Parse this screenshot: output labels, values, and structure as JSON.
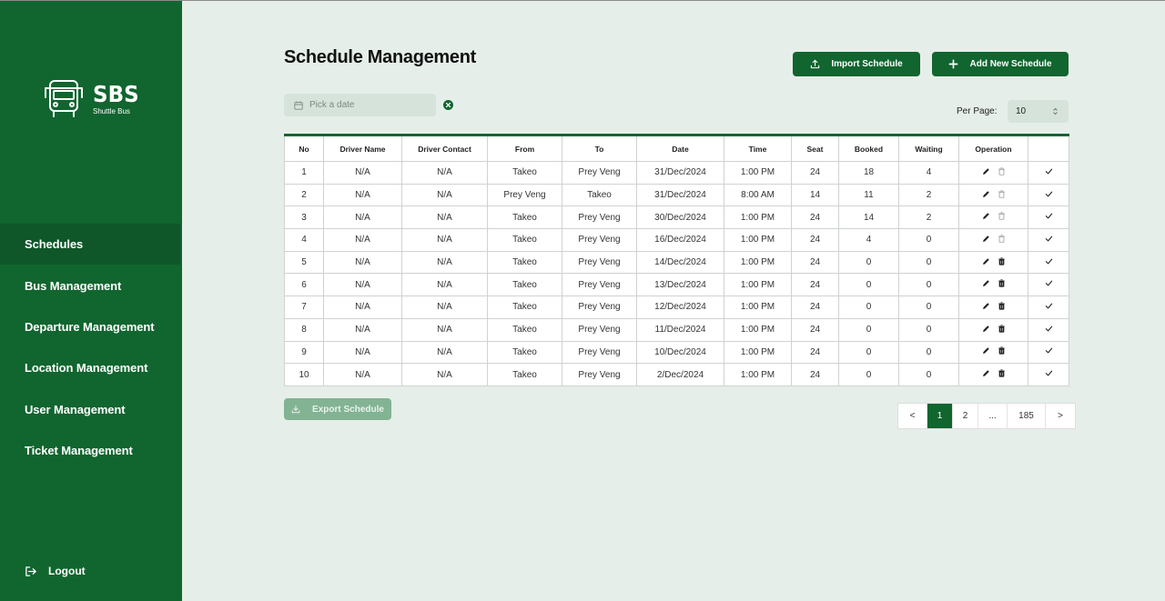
{
  "app": {
    "brand": "SBS",
    "brand_sub": "Shuttle Bus"
  },
  "sidebar": {
    "items": [
      {
        "label": "Schedules",
        "active": true
      },
      {
        "label": "Bus Management"
      },
      {
        "label": "Departure Management"
      },
      {
        "label": "Location Management"
      },
      {
        "label": "User Management"
      },
      {
        "label": "Ticket Management"
      }
    ],
    "logout_label": "Logout"
  },
  "header": {
    "title": "Schedule Management",
    "import_label": "Import Schedule",
    "add_label": "Add New Schedule"
  },
  "filters": {
    "date_placeholder": "Pick a date",
    "per_page_label": "Per Page:",
    "per_page_value": "10"
  },
  "table": {
    "columns": [
      "No",
      "Driver Name",
      "Driver Contact",
      "From",
      "To",
      "Date",
      "Time",
      "Seat",
      "Booked",
      "Waiting",
      "Operation",
      ""
    ],
    "rows": [
      {
        "no": "1",
        "driver": "N/A",
        "contact": "N/A",
        "from": "Takeo",
        "to": "Prey Veng",
        "date": "31/Dec/2024",
        "time": "1:00 PM",
        "seat": "24",
        "booked": "18",
        "waiting": "4",
        "delete_enabled": false
      },
      {
        "no": "2",
        "driver": "N/A",
        "contact": "N/A",
        "from": "Prey Veng",
        "to": "Takeo",
        "date": "31/Dec/2024",
        "time": "8:00 AM",
        "seat": "14",
        "booked": "11",
        "waiting": "2",
        "delete_enabled": false
      },
      {
        "no": "3",
        "driver": "N/A",
        "contact": "N/A",
        "from": "Takeo",
        "to": "Prey Veng",
        "date": "30/Dec/2024",
        "time": "1:00 PM",
        "seat": "24",
        "booked": "14",
        "waiting": "2",
        "delete_enabled": false
      },
      {
        "no": "4",
        "driver": "N/A",
        "contact": "N/A",
        "from": "Takeo",
        "to": "Prey Veng",
        "date": "16/Dec/2024",
        "time": "1:00 PM",
        "seat": "24",
        "booked": "4",
        "waiting": "0",
        "delete_enabled": false
      },
      {
        "no": "5",
        "driver": "N/A",
        "contact": "N/A",
        "from": "Takeo",
        "to": "Prey Veng",
        "date": "14/Dec/2024",
        "time": "1:00 PM",
        "seat": "24",
        "booked": "0",
        "waiting": "0",
        "delete_enabled": true
      },
      {
        "no": "6",
        "driver": "N/A",
        "contact": "N/A",
        "from": "Takeo",
        "to": "Prey Veng",
        "date": "13/Dec/2024",
        "time": "1:00 PM",
        "seat": "24",
        "booked": "0",
        "waiting": "0",
        "delete_enabled": true
      },
      {
        "no": "7",
        "driver": "N/A",
        "contact": "N/A",
        "from": "Takeo",
        "to": "Prey Veng",
        "date": "12/Dec/2024",
        "time": "1:00 PM",
        "seat": "24",
        "booked": "0",
        "waiting": "0",
        "delete_enabled": true
      },
      {
        "no": "8",
        "driver": "N/A",
        "contact": "N/A",
        "from": "Takeo",
        "to": "Prey Veng",
        "date": "11/Dec/2024",
        "time": "1:00 PM",
        "seat": "24",
        "booked": "0",
        "waiting": "0",
        "delete_enabled": true
      },
      {
        "no": "9",
        "driver": "N/A",
        "contact": "N/A",
        "from": "Takeo",
        "to": "Prey Veng",
        "date": "10/Dec/2024",
        "time": "1:00 PM",
        "seat": "24",
        "booked": "0",
        "waiting": "0",
        "delete_enabled": true
      },
      {
        "no": "10",
        "driver": "N/A",
        "contact": "N/A",
        "from": "Takeo",
        "to": "Prey Veng",
        "date": "2/Dec/2024",
        "time": "1:00 PM",
        "seat": "24",
        "booked": "0",
        "waiting": "0",
        "delete_enabled": true
      }
    ]
  },
  "footer": {
    "export_label": "Export Schedule",
    "pagination": {
      "prev": "<",
      "pages": [
        "1",
        "2",
        "...",
        "185"
      ],
      "current": "1",
      "next": ">"
    }
  },
  "colors": {
    "primary": "#11652f",
    "sidebar_active": "#0f5629",
    "background": "#e6eee9",
    "input_bg": "#d6e3da",
    "export_disabled": "#82b393"
  },
  "icons": {
    "logo": "bus-icon",
    "import": "upload-icon",
    "add": "plus-icon",
    "date": "calendar-icon",
    "clear": "clear-circle-icon",
    "select": "chevron-updown-icon",
    "edit": "pencil-icon",
    "delete": "trash-icon",
    "confirm": "check-icon",
    "export": "download-icon",
    "logout": "logout-icon"
  }
}
